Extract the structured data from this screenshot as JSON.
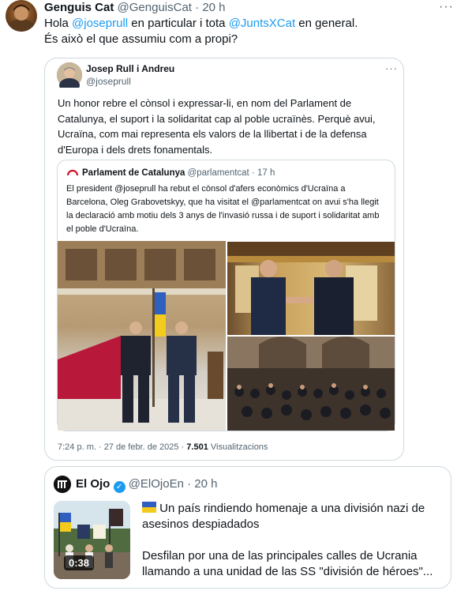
{
  "tweet": {
    "author_name": "Genguis Cat",
    "author_handle": "@GenguisCat",
    "separator": "·",
    "time": "20 h",
    "more": "···",
    "text_part1": "Hola ",
    "mention1": "@joseprull",
    "text_part2": " en particular i tota ",
    "mention2": "@JuntsXCat",
    "text_part3": " en general.",
    "text_line2": "És això el que assumiu com a propi?"
  },
  "quoted": {
    "author_name": "Josep Rull i Andreu",
    "author_handle": "@joseprull",
    "more": "···",
    "text": "Un honor rebre el cònsol i expressar-li, en nom del Parlament de Catalunya, el suport i la solidaritat cap al poble ucraïnès. Perquè avui, Ucraïna, com mai representa els valors de la llibertat i de la defensa d'Europa i dels drets fonamentals.",
    "timestamp": "7:24 p. m. · 27 de febr. de 2025 · ",
    "views_count": "7.501",
    "views_label": " Visualitzacions"
  },
  "nested": {
    "author_name": "Parlament de Catalunya",
    "author_handle": "@parlamentcat",
    "separator": "·",
    "time": "17 h",
    "text": "El president @joseprull ha rebut el cònsol d'afers econòmics d'Ucraïna a Barcelona, Oleg Grabovetskyy, que ha visitat el @parlamentcat on avui s'ha llegit la declaració amb motiu dels 3 anys de l'invasió russa i de suport i solidaritat amb el poble d'Ucraïna."
  },
  "third": {
    "author_name": "El Ojo",
    "author_handle": "@ElOjoEn",
    "separator": "·",
    "time": "20 h",
    "video_duration": "0:38",
    "text_line1": " Un país rindiendo homenaje a una división nazi de asesinos despiadados",
    "text_line2": "Desfilan por una de las principales calles de Ucrania llamando a una unidad de las SS \"división de héroes\"..."
  },
  "colors": {
    "link": "#1d9bf0",
    "muted": "#536471",
    "border": "#cfd9de"
  }
}
